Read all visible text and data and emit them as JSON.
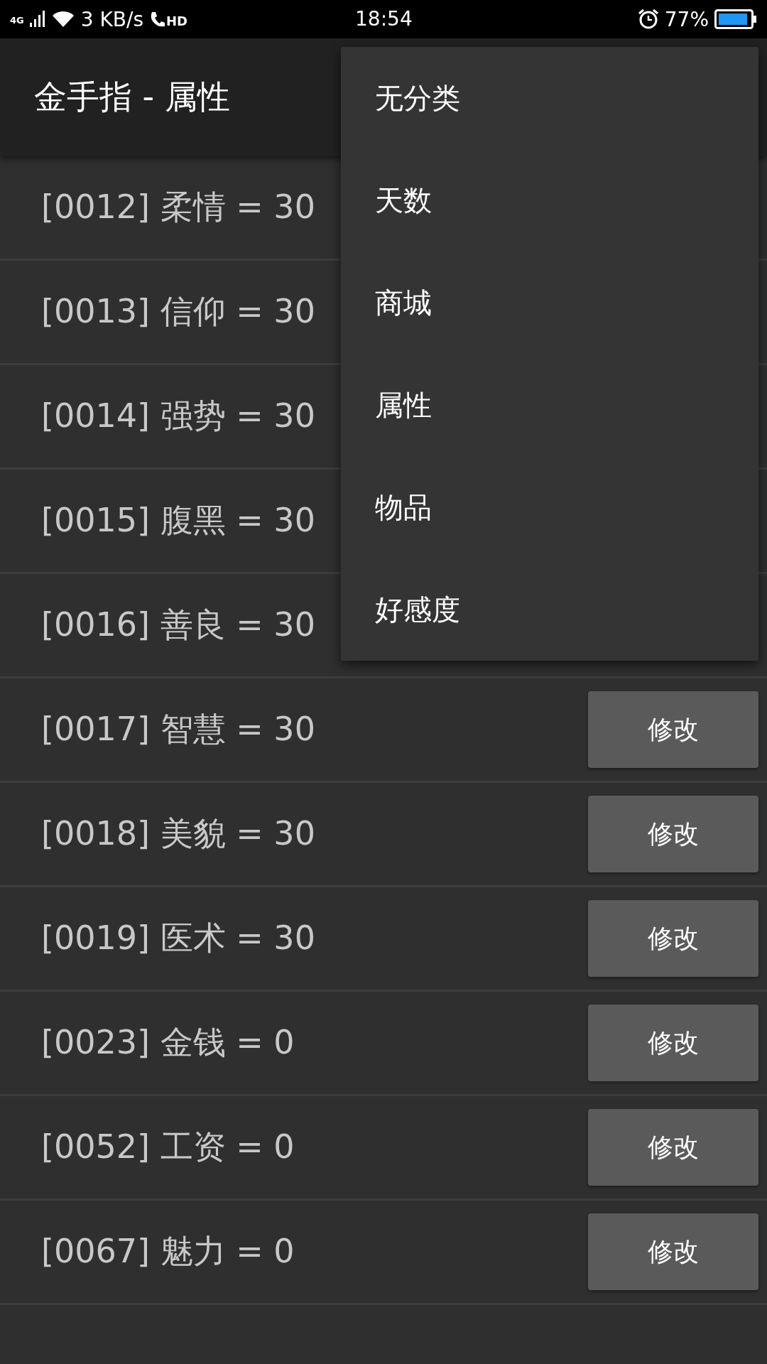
{
  "status_bar": {
    "network": "4G",
    "speed": "3 KB/s",
    "call_badge": "HD",
    "time": "18:54",
    "battery": "77%"
  },
  "app_bar": {
    "title": "金手指 - 属性"
  },
  "rows": [
    {
      "label": "[0012] 柔情 = 30"
    },
    {
      "label": "[0013] 信仰 = 30"
    },
    {
      "label": "[0014] 强势 = 30"
    },
    {
      "label": "[0015] 腹黑 = 30"
    },
    {
      "label": "[0016] 善良 = 30"
    },
    {
      "label": "[0017] 智慧 = 30",
      "button": "修改"
    },
    {
      "label": "[0018] 美貌 = 30",
      "button": "修改"
    },
    {
      "label": "[0019] 医术 = 30",
      "button": "修改"
    },
    {
      "label": "[0023] 金钱 = 0",
      "button": "修改"
    },
    {
      "label": "[0052] 工资 = 0",
      "button": "修改"
    },
    {
      "label": "[0067] 魅力 = 0",
      "button": "修改"
    }
  ],
  "menu": {
    "items": [
      "无分类",
      "天数",
      "商城",
      "属性",
      "物品",
      "好感度"
    ]
  }
}
